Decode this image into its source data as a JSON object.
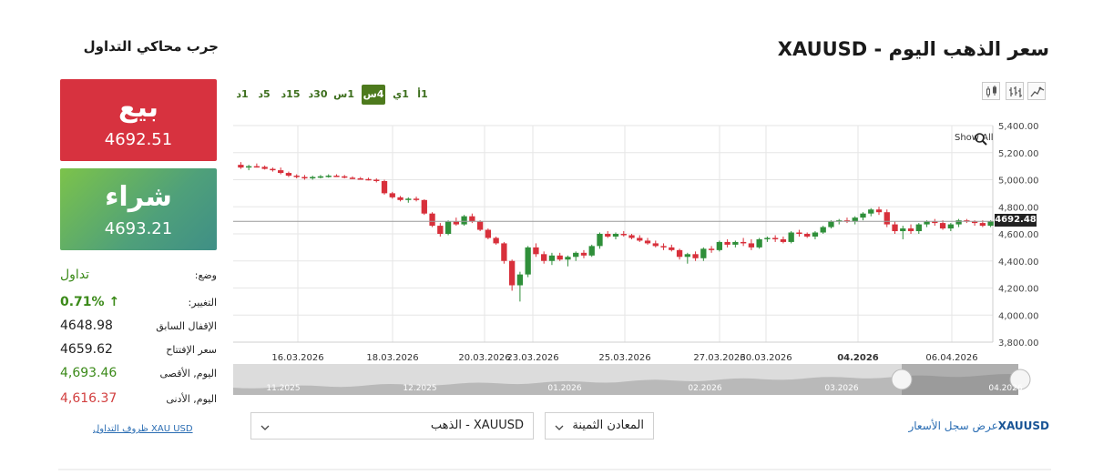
{
  "header": {
    "title": "سعر الذهب اليوم - XAUUSD",
    "try_simulator": "جرب محاكي التداول"
  },
  "timeframes": [
    {
      "label": "1أ",
      "active": false
    },
    {
      "label": "1ي",
      "active": false
    },
    {
      "label": "4س",
      "active": true
    },
    {
      "label": "1س",
      "active": false
    },
    {
      "label": "30د",
      "active": false
    },
    {
      "label": "15د",
      "active": false
    },
    {
      "label": "5د",
      "active": false
    },
    {
      "label": "1د",
      "active": false
    }
  ],
  "chart_type_icons": [
    "candles-icon",
    "bars-icon",
    "line-icon"
  ],
  "chart": {
    "show_all": "Show All",
    "current_price": "4692.48",
    "y_ticks": [
      "5,400.00",
      "5,200.00",
      "5,000.00",
      "4,800.00",
      "4,600.00",
      "4,400.00",
      "4,200.00",
      "4,000.00",
      "3,800.00"
    ],
    "x_ticks": [
      "16.03.2026",
      "18.03.2026",
      "20.03.2026",
      "23.03.2026",
      "25.03.2026",
      "27.03.2026",
      "30.03.2026",
      "04.2026",
      "06.04.2026"
    ],
    "navigator_ticks": [
      "11.2025",
      "12.2025",
      "01.2026",
      "02.2026",
      "03.2026",
      "04.2026"
    ]
  },
  "chart_data": {
    "type": "candlestick",
    "ylim": [
      3800,
      5400
    ],
    "current": 4692.48,
    "up_color": "#2f8f3a",
    "down_color": "#d8303b",
    "candles": [
      [
        5110,
        5130,
        5080,
        5090
      ],
      [
        5090,
        5110,
        5070,
        5100
      ],
      [
        5100,
        5120,
        5090,
        5095
      ],
      [
        5095,
        5105,
        5075,
        5080
      ],
      [
        5080,
        5090,
        5060,
        5070
      ],
      [
        5070,
        5090,
        5040,
        5050
      ],
      [
        5050,
        5060,
        5020,
        5030
      ],
      [
        5030,
        5040,
        5010,
        5020
      ],
      [
        5020,
        5035,
        5000,
        5015
      ],
      [
        5015,
        5030,
        5000,
        5020
      ],
      [
        5020,
        5035,
        5010,
        5025
      ],
      [
        5025,
        5040,
        5015,
        5030
      ],
      [
        5030,
        5040,
        5020,
        5025
      ],
      [
        5025,
        5035,
        5010,
        5015
      ],
      [
        5015,
        5025,
        5005,
        5010
      ],
      [
        5010,
        5020,
        5000,
        5005
      ],
      [
        5005,
        5015,
        4995,
        5000
      ],
      [
        5000,
        5010,
        4980,
        4990
      ],
      [
        4990,
        5000,
        4890,
        4900
      ],
      [
        4900,
        4910,
        4860,
        4870
      ],
      [
        4870,
        4880,
        4840,
        4850
      ],
      [
        4850,
        4870,
        4830,
        4860
      ],
      [
        4860,
        4875,
        4840,
        4850
      ],
      [
        4850,
        4855,
        4740,
        4750
      ],
      [
        4750,
        4760,
        4650,
        4660
      ],
      [
        4660,
        4680,
        4580,
        4600
      ],
      [
        4600,
        4700,
        4590,
        4690
      ],
      [
        4690,
        4720,
        4660,
        4670
      ],
      [
        4670,
        4740,
        4660,
        4730
      ],
      [
        4730,
        4750,
        4680,
        4690
      ],
      [
        4690,
        4700,
        4620,
        4630
      ],
      [
        4630,
        4640,
        4560,
        4570
      ],
      [
        4570,
        4580,
        4520,
        4530
      ],
      [
        4530,
        4540,
        4380,
        4400
      ],
      [
        4400,
        4410,
        4180,
        4220
      ],
      [
        4220,
        4320,
        4100,
        4300
      ],
      [
        4300,
        4510,
        4280,
        4500
      ],
      [
        4500,
        4530,
        4430,
        4450
      ],
      [
        4450,
        4470,
        4380,
        4400
      ],
      [
        4400,
        4460,
        4370,
        4440
      ],
      [
        4440,
        4460,
        4400,
        4410
      ],
      [
        4410,
        4440,
        4360,
        4430
      ],
      [
        4430,
        4470,
        4400,
        4460
      ],
      [
        4460,
        4480,
        4420,
        4440
      ],
      [
        4440,
        4520,
        4430,
        4510
      ],
      [
        4510,
        4610,
        4490,
        4600
      ],
      [
        4600,
        4620,
        4570,
        4580
      ],
      [
        4580,
        4610,
        4560,
        4600
      ],
      [
        4600,
        4620,
        4580,
        4590
      ],
      [
        4590,
        4600,
        4560,
        4570
      ],
      [
        4570,
        4590,
        4540,
        4550
      ],
      [
        4550,
        4570,
        4520,
        4530
      ],
      [
        4530,
        4550,
        4500,
        4510
      ],
      [
        4510,
        4530,
        4480,
        4500
      ],
      [
        4500,
        4520,
        4470,
        4480
      ],
      [
        4480,
        4490,
        4410,
        4430
      ],
      [
        4430,
        4460,
        4380,
        4450
      ],
      [
        4450,
        4470,
        4400,
        4420
      ],
      [
        4420,
        4500,
        4400,
        4490
      ],
      [
        4490,
        4510,
        4460,
        4480
      ],
      [
        4480,
        4550,
        4470,
        4540
      ],
      [
        4540,
        4560,
        4500,
        4520
      ],
      [
        4520,
        4550,
        4500,
        4540
      ],
      [
        4540,
        4570,
        4510,
        4530
      ],
      [
        4530,
        4560,
        4480,
        4500
      ],
      [
        4500,
        4570,
        4490,
        4560
      ],
      [
        4560,
        4580,
        4540,
        4570
      ],
      [
        4570,
        4590,
        4540,
        4560
      ],
      [
        4560,
        4580,
        4530,
        4540
      ],
      [
        4540,
        4620,
        4530,
        4610
      ],
      [
        4610,
        4630,
        4580,
        4600
      ],
      [
        4600,
        4610,
        4570,
        4580
      ],
      [
        4580,
        4620,
        4560,
        4610
      ],
      [
        4610,
        4660,
        4600,
        4650
      ],
      [
        4650,
        4700,
        4640,
        4690
      ],
      [
        4690,
        4710,
        4670,
        4700
      ],
      [
        4700,
        4720,
        4680,
        4690
      ],
      [
        4690,
        4730,
        4670,
        4720
      ],
      [
        4720,
        4760,
        4700,
        4750
      ],
      [
        4750,
        4790,
        4730,
        4780
      ],
      [
        4780,
        4800,
        4740,
        4760
      ],
      [
        4760,
        4780,
        4650,
        4670
      ],
      [
        4670,
        4690,
        4600,
        4620
      ],
      [
        4620,
        4660,
        4560,
        4640
      ],
      [
        4640,
        4670,
        4600,
        4620
      ],
      [
        4620,
        4680,
        4600,
        4670
      ],
      [
        4670,
        4700,
        4650,
        4690
      ],
      [
        4690,
        4710,
        4660,
        4680
      ],
      [
        4680,
        4700,
        4630,
        4640
      ],
      [
        4640,
        4680,
        4620,
        4670
      ],
      [
        4670,
        4710,
        4650,
        4700
      ],
      [
        4700,
        4710,
        4680,
        4690
      ],
      [
        4690,
        4700,
        4660,
        4680
      ],
      [
        4680,
        4700,
        4650,
        4660
      ],
      [
        4660,
        4700,
        4650,
        4692
      ]
    ]
  },
  "selectors": {
    "history_link_symbol": "XAUUSD",
    "history_link_text": "عرض سجل الأسعار",
    "category": "المعادن الثمينة",
    "instrument": "XAUUSD - الذهب"
  },
  "panel": {
    "sell_label": "بيع",
    "sell_price": "4692.51",
    "buy_label": "شراء",
    "buy_price": "4693.21",
    "stats": [
      {
        "label": "وضع:",
        "value": "تداول",
        "color": "green"
      },
      {
        "label": "التغيير:",
        "value": "0.71% ↑",
        "color": "green"
      },
      {
        "label": "الإقفال السابق",
        "value": "4648.98",
        "color": "default"
      },
      {
        "label": "سعر الإفتتاح",
        "value": "4659.62",
        "color": "default"
      },
      {
        "label": "اليوم, الأقصى",
        "value": "4,693.46",
        "color": "green"
      },
      {
        "label": "اليوم, الأدنى",
        "value": "4,616.37",
        "color": "red"
      }
    ],
    "conditions_link": "XAU USD ظروف التداول"
  }
}
